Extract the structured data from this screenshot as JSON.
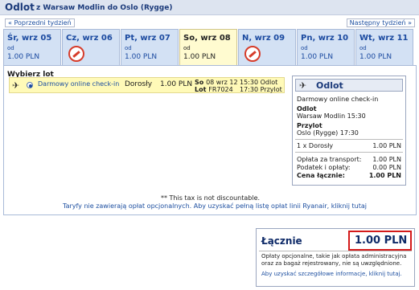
{
  "header": {
    "title": "Odlot",
    "route": "z Warsaw Modlin do Oslo (Rygge)"
  },
  "nav": {
    "prev_week": "« Poprzedni tydzień",
    "next_week": "Następny tydzień »"
  },
  "days": [
    {
      "name": "Śr, wrz 05",
      "od": "od",
      "price": "1.00 PLN",
      "available": true
    },
    {
      "name": "Cz, wrz 06",
      "od": "",
      "price": "",
      "available": false,
      "icon": "no-flights-icon"
    },
    {
      "name": "Pt, wrz 07",
      "od": "od",
      "price": "1.00 PLN",
      "available": true
    },
    {
      "name": "So, wrz 08",
      "od": "od",
      "price": "1.00 PLN",
      "available": true,
      "selected": true
    },
    {
      "name": "N, wrz 09",
      "od": "",
      "price": "",
      "available": false,
      "icon": "no-flights-icon"
    },
    {
      "name": "Pn, wrz 10",
      "od": "od",
      "price": "1.00 PLN",
      "available": true
    },
    {
      "name": "Wt, wrz 11",
      "od": "od",
      "price": "1.00 PLN",
      "available": true
    }
  ],
  "flights": {
    "heading": "Wybierz lot",
    "row": {
      "fare_type": "Darmowy online check-in",
      "passenger": "Dorosły",
      "price": "1.00 PLN",
      "day_label": "So",
      "date": "08 wrz 12",
      "flight_label": "Lot",
      "flight_no": "FR7024",
      "dep_time": "15:30",
      "dep_label": "Odlot",
      "arr_time": "17:30",
      "arr_label": "Przylot"
    }
  },
  "summary": {
    "title": "Odlot",
    "fare": "Darmowy online check-in",
    "dep_label": "Odlot",
    "dep_place": "Warsaw Modlin 15:30",
    "arr_label": "Przylot",
    "arr_place": "Oslo (Rygge) 17:30",
    "pax_line": "1 x Dorosły",
    "pax_price": "1.00 PLN",
    "transport_label": "Opłata za transport:",
    "transport_value": "1.00 PLN",
    "tax_label": "Podatek i opłaty:",
    "tax_value": "0.00 PLN",
    "total_label": "Cena łącznie:",
    "total_value": "1.00 PLN"
  },
  "footnote": "** This tax is not discountable.",
  "taryfy_link": "Taryfy nie zawierają opłat opcjonalnych. Aby uzyskać pełną listę opłat linii Ryanair, kliknij tutaj",
  "total": {
    "label": "Łącznie",
    "price": "1.00 PLN",
    "note": "Opłaty opcjonalne, takie jak opłata administracyjna oraz za bagaż rejestrowany, nie są uwzględnione.",
    "link": "Aby uzyskać szczegółowe informacje, kliknij tutaj."
  },
  "colors": {
    "header_bg": "#dde4f0",
    "selected_day": "#fffbd0",
    "link_blue": "#1d4fa0",
    "highlight_red": "#d41a1a"
  }
}
